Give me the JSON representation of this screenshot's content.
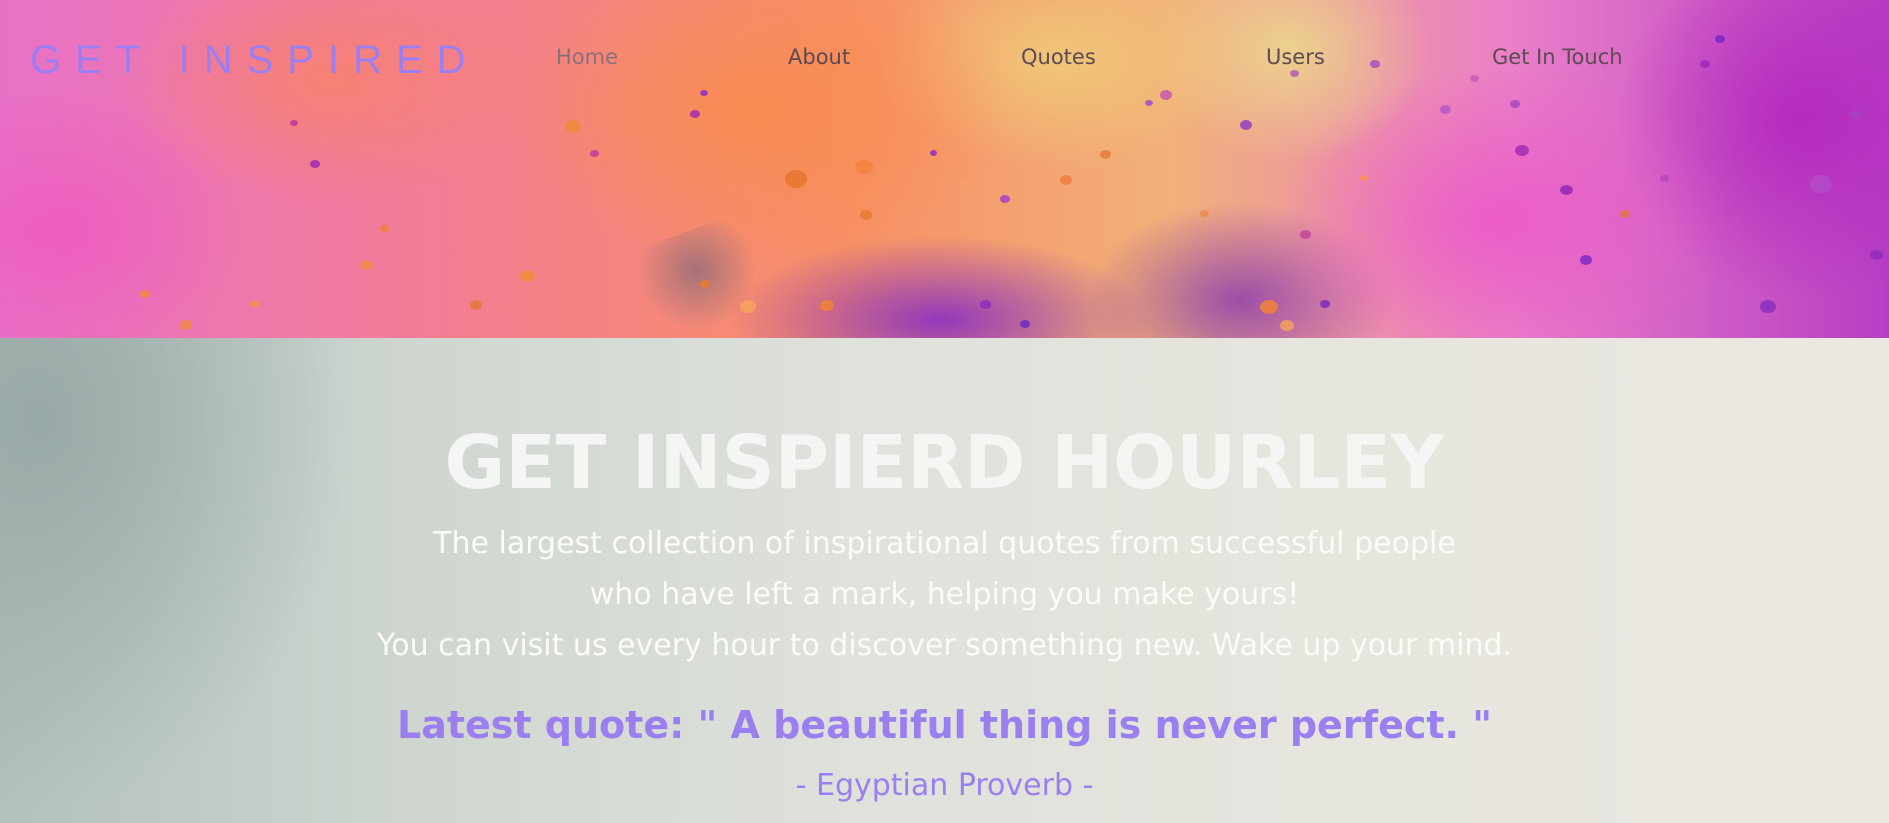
{
  "brand": "GET INSPIRED",
  "nav": {
    "items": [
      {
        "label": "Home"
      },
      {
        "label": "About"
      },
      {
        "label": "Quotes"
      },
      {
        "label": "Users"
      },
      {
        "label": "Get In Touch"
      }
    ]
  },
  "hero": {
    "headline": "GET INSPIERD HOURLEY",
    "tagline_lines": [
      "The largest collection of inspirational quotes from successful people",
      "who have left a mark, helping you make yours!",
      "You can visit us every hour to discover something new. Wake up your mind."
    ],
    "quote_prefix": "Latest quote: ",
    "quote_text": "Latest quote: \" A beautiful thing is never perfect. \"",
    "quote_author": "- Egyptian Proverb -"
  },
  "colors": {
    "accent": "#9b7ff0",
    "headline": "#f5f6f4",
    "nav_text": "#5d4a52"
  }
}
